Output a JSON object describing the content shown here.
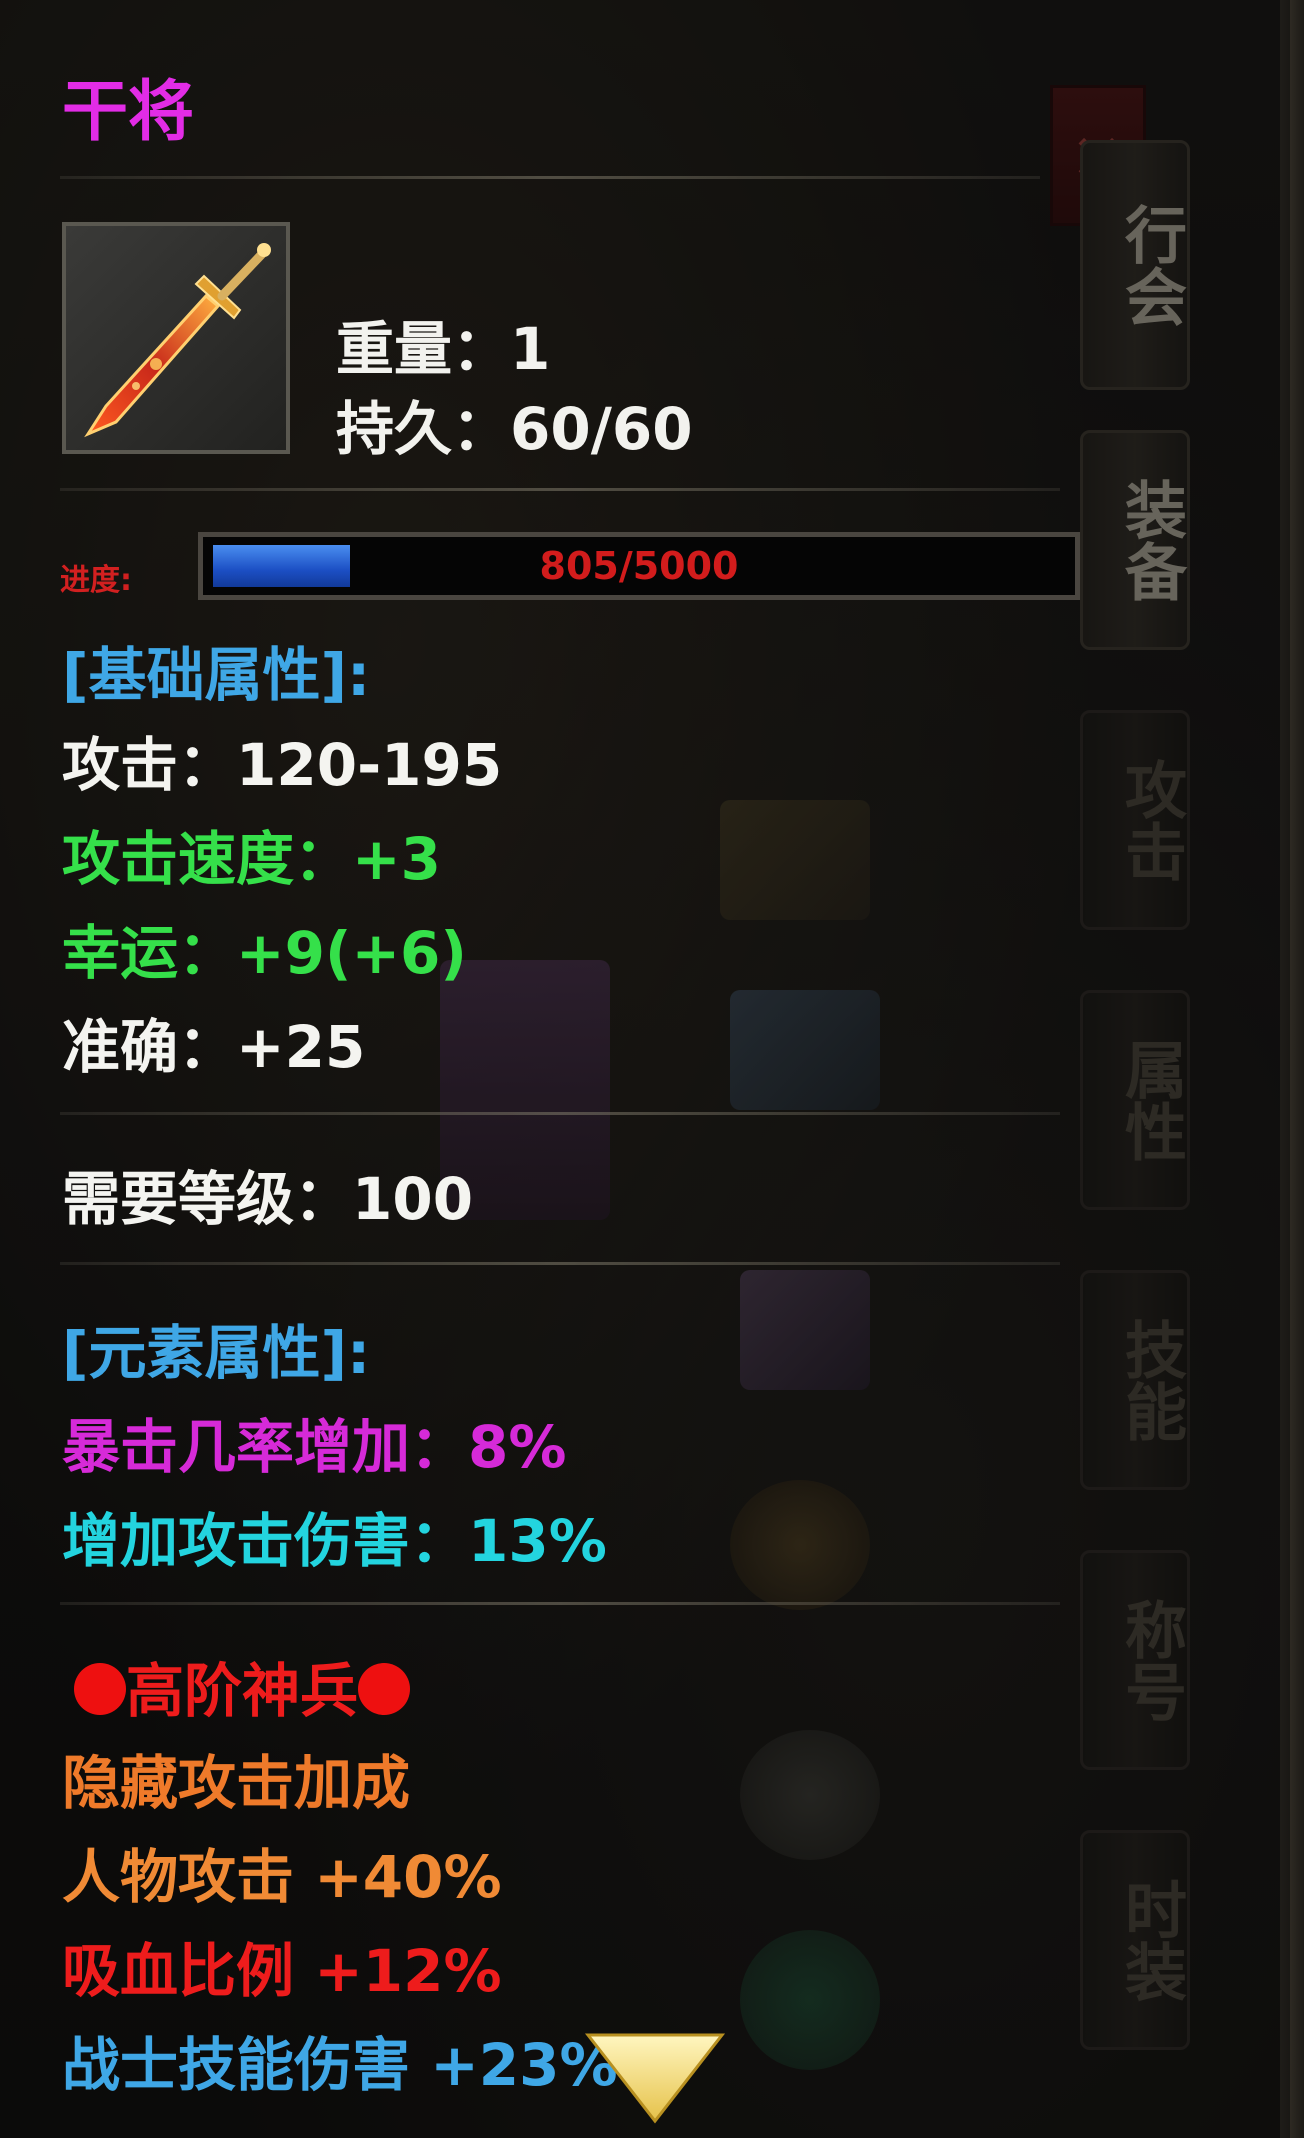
{
  "side_tabs": [
    "行会",
    "装备",
    "攻击",
    "属性",
    "技能",
    "称号",
    "时装"
  ],
  "close_label": "×",
  "item": {
    "name": "干将",
    "weight_label": "重量：",
    "weight": "1",
    "durability_label": "持久：",
    "durability": "60/60",
    "icon": "sword-icon"
  },
  "progress": {
    "label": "进度:",
    "text": "805/5000",
    "current": 805,
    "max": 5000
  },
  "basic": {
    "header": "[基础属性]:",
    "attack": "攻击：120-195",
    "attack_speed": "攻击速度：+3",
    "luck": "幸运：+9(+6)",
    "accuracy": "准确：+25"
  },
  "requirement": {
    "level": "需要等级：100"
  },
  "element": {
    "header": "[元素属性]:",
    "crit": "暴击几率增加：8%",
    "damage": "增加攻击伤害：13%"
  },
  "advanced": {
    "title": "高阶神兵",
    "hidden_bonus": "隐藏攻击加成",
    "char_attack": "人物攻击 +40%",
    "lifesteal": "吸血比例 +12%",
    "warrior_skill": "战士技能伤害 +23%"
  },
  "colors": {
    "name": "#e22ce6",
    "header": "#3fa7e6",
    "green": "#35e04a",
    "magenta": "#d62ad8",
    "teal": "#23d4df",
    "red": "#ee1c1c",
    "orange": "#ef7a2a",
    "progress_fill": "#2a6ad8"
  }
}
